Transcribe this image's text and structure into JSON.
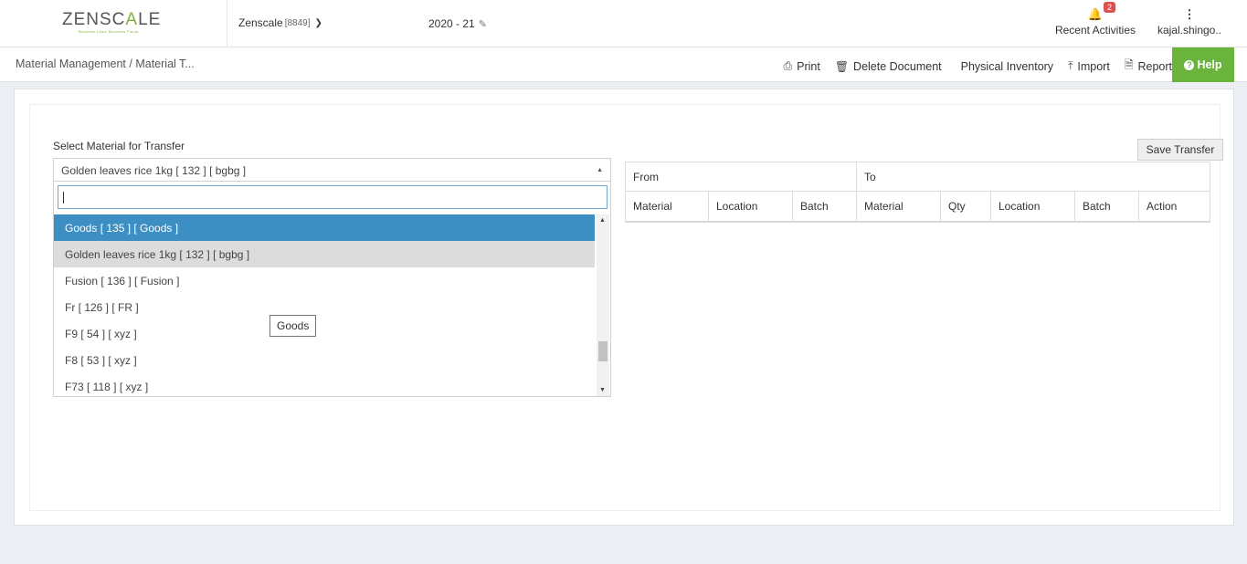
{
  "header": {
    "logo_part1": "ZENSC",
    "logo_part2": "A",
    "logo_part3": "LE",
    "logo_tagline": "Business Lean. Business Focus.",
    "company_name": "Zenscale",
    "company_code": "[8849]",
    "fiscal_year": "2020 - 21",
    "notifications_count": "2",
    "recent_activities_label": "Recent Activities",
    "user_name": "kajal.shingo.."
  },
  "toolbar": {
    "breadcrumb_root": "Material Management",
    "breadcrumb_current": "/ Material T...",
    "print_label": "Print",
    "delete_label": "Delete Document",
    "physical_inventory_label": "Physical Inventory",
    "import_label": "Import",
    "report_label": "Report",
    "help_label": "Help"
  },
  "form": {
    "select_label": "Select Material for Transfer",
    "selected_value": "Golden leaves rice 1kg [ 132 ] [ bgbg ]",
    "save_label": "Save Transfer",
    "tooltip": "Goods",
    "options": [
      "Goods [ 135 ] [ Goods ]",
      "Golden leaves rice 1kg [ 132 ] [ bgbg ]",
      "Fusion [ 136 ] [ Fusion ]",
      "Fr [ 126 ] [ FR ]",
      "F9 [ 54 ] [ xyz ]",
      "F8 [ 53 ] [ xyz ]",
      "F73 [ 118 ] [ xyz ]"
    ]
  },
  "table": {
    "group_from": "From",
    "group_to": "To",
    "columns": [
      "Material",
      "Location",
      "Batch",
      "Material",
      "Qty",
      "Location",
      "Batch",
      "Action"
    ]
  },
  "colors": {
    "brand_green": "#6ab43e",
    "selection_blue": "#3d8fc3",
    "badge_red": "#d9534f"
  }
}
